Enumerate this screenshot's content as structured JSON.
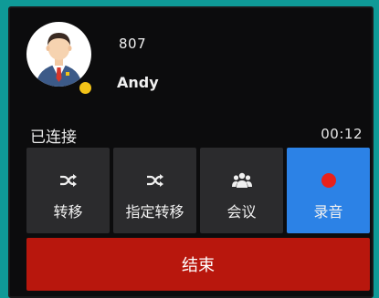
{
  "caller": {
    "extension": "807",
    "name": "Andy",
    "avatar_icon": "businessman-avatar-icon",
    "presence_color": "#f2c318"
  },
  "call": {
    "status": "已连接",
    "duration": "00:12"
  },
  "actions": [
    {
      "label": "转移",
      "icon": "shuffle-icon"
    },
    {
      "label": "指定转移",
      "icon": "shuffle-icon"
    },
    {
      "label": "会议",
      "icon": "group-icon"
    },
    {
      "label": "录音",
      "icon": "record-icon",
      "active": true
    }
  ],
  "end_button": {
    "label": "结束",
    "color": "#b8170d"
  },
  "colors": {
    "background": "#0f9a97",
    "panel": "#0c0c0d",
    "button": "#2b2b2d",
    "record_active": "#2c82e6",
    "record_dot": "#e8211c"
  }
}
